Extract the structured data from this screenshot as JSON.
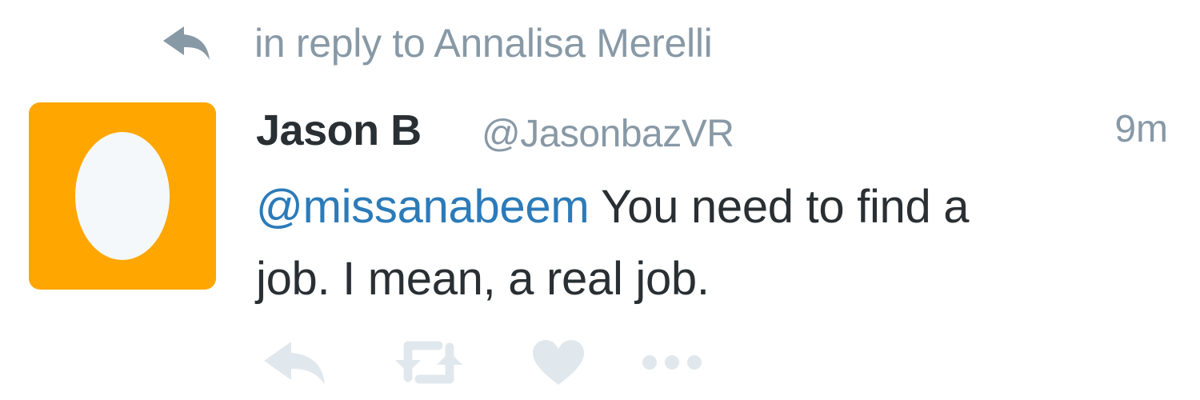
{
  "reply_context": {
    "text": "in reply to Annalisa Merelli",
    "icon": "reply-arrow-icon"
  },
  "tweet": {
    "author_name": "Jason B",
    "author_handle": "@JasonbazVR",
    "timestamp": "9m",
    "mention": "@missanabeem",
    "text_line1": " You need to find a",
    "text_line2": "job. I mean, a real job."
  },
  "avatar": {
    "icon": "default-egg-avatar-icon",
    "background_color": "#ffa600",
    "egg_color": "#f5f8fa"
  },
  "actions": [
    {
      "name": "reply",
      "icon": "reply-icon"
    },
    {
      "name": "retweet",
      "icon": "retweet-icon"
    },
    {
      "name": "like",
      "icon": "heart-icon"
    },
    {
      "name": "more",
      "icon": "more-dots-icon"
    }
  ],
  "colors": {
    "muted": "#8899a6",
    "text": "#292f33",
    "link": "#2b7bb9",
    "action_icons": "#e1e8ed"
  }
}
